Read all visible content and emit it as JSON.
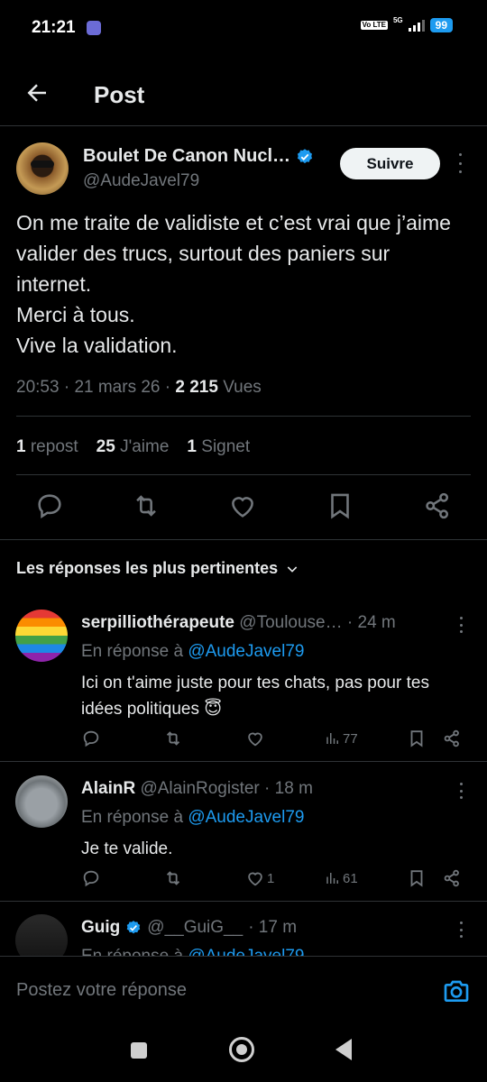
{
  "status_bar": {
    "time": "21:21",
    "volte": "Vo LTE",
    "network": "5G",
    "battery": "99"
  },
  "header": {
    "title": "Post"
  },
  "tweet": {
    "author_name": "Boulet De Canon Nucl…",
    "author_handle": "@AudeJavel79",
    "follow_label": "Suivre",
    "text": "On me traite de validiste et c’est vrai que j’aime valider des trucs, surtout des paniers sur internet.\nMerci à tous.\nVive la validation.",
    "time": "20:53",
    "date": "21 mars 26",
    "views_count": "2 215",
    "views_label": "Vues",
    "reposts_count": "1",
    "reposts_label": "repost",
    "likes_count": "25",
    "likes_label": "J'aime",
    "bookmarks_count": "1",
    "bookmarks_label": "Signet"
  },
  "replies_sort_label": "Les réponses les plus pertinentes",
  "replies": [
    {
      "name": "serpilliothérapeute",
      "handle": "@Toulouse…",
      "time": "· 24 m",
      "in_reply_prefix": "En réponse à",
      "in_reply_mention": "@AudeJavel79",
      "text": "Ici on t'aime juste pour tes chats, pas pour tes idées politiques 😇",
      "likes": "",
      "views": "77"
    },
    {
      "name": "AlainR",
      "handle": "@AlainRogister",
      "time": "· 18 m",
      "in_reply_prefix": "En réponse à",
      "in_reply_mention": "@AudeJavel79",
      "text": "Je te valide.",
      "likes": "1",
      "views": "61"
    },
    {
      "name": "Guig",
      "handle": "@__GuiG__",
      "time": "· 17 m",
      "in_reply_prefix": "En réponse à",
      "in_reply_mention": "@AudeJavel79"
    }
  ],
  "compose": {
    "placeholder": "Postez votre réponse"
  },
  "colors": {
    "accent": "#1d9bf0",
    "background": "#000000",
    "muted": "#71767b",
    "text": "#e7e9ea"
  }
}
